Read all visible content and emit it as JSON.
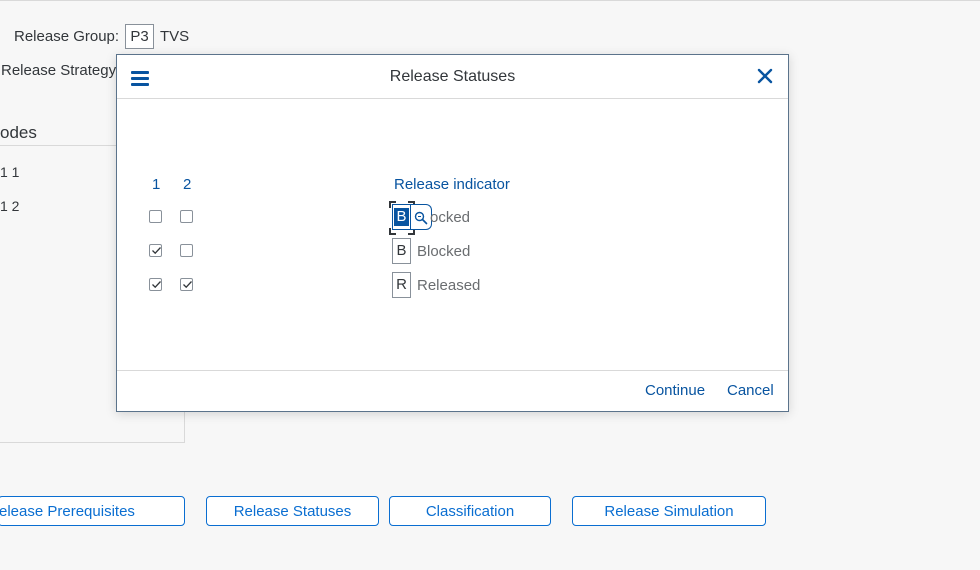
{
  "background": {
    "release_group_label": "Release Group:",
    "release_group_value": "P3",
    "release_group_desc": "TVS",
    "release_strategy_label": "Release Strategy",
    "codes_title": "odes",
    "codes_items": [
      "1 1",
      "1 2"
    ]
  },
  "action_buttons": {
    "release_prerequisites": "elease Prerequisites",
    "release_statuses": "Release Statuses",
    "classification": "Classification",
    "release_simulation": "Release Simulation"
  },
  "dialog": {
    "title": "Release Statuses",
    "columns": [
      "1",
      "2"
    ],
    "release_indicator_header": "Release indicator",
    "rows": [
      {
        "c1": false,
        "c2": false,
        "indicator": "B",
        "text": "ocked"
      },
      {
        "c1": true,
        "c2": false,
        "indicator": "B",
        "text": "Blocked"
      },
      {
        "c1": true,
        "c2": true,
        "indicator": "R",
        "text": "Released"
      }
    ],
    "continue_label": "Continue",
    "cancel_label": "Cancel"
  },
  "colors": {
    "accent": "#0854a0",
    "button_border": "#0a6ed1",
    "background": "#f7f7f7"
  },
  "icons": [
    "menu-icon",
    "close-icon",
    "value-help-icon",
    "checkmark-icon"
  ]
}
